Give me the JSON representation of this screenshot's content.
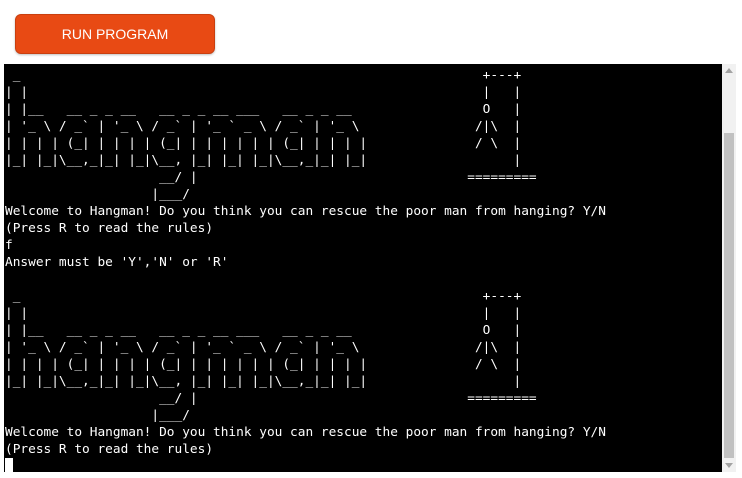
{
  "run_button": {
    "label": "RUN PROGRAM",
    "color": "#e84a14"
  },
  "terminal": {
    "background": "#000000",
    "foreground": "#ffffff",
    "lines": [
      " _                                                            +---+",
      "| |                                                           |   |",
      "| |__   __ _ _ __   __ _ _ __ ___   __ _ _ __                 O   |",
      "| '_ \\ / _` | '_ \\ / _` | '_ ` _ \\ / _` | '_ \\               /|\\  |",
      "| | | | (_| | | | | (_| | | | | | | (_| | | | |              / \\  |",
      "|_| |_|\\__,_|_| |_|\\__, |_| |_| |_|\\__,_|_| |_|                   |",
      "                    __/ |                                   =========",
      "                   |___/",
      "Welcome to Hangman! Do you think you can rescue the poor man from hanging? Y/N",
      "(Press R to read the rules)",
      "f",
      "Answer must be 'Y','N' or 'R'",
      "",
      " _                                                            +---+",
      "| |                                                           |   |",
      "| |__   __ _ _ __   __ _ _ __ ___   __ _ _ __                 O   |",
      "| '_ \\ / _` | '_ \\ / _` | '_ ` _ \\ / _` | '_ \\               /|\\  |",
      "| | | | (_| | | | | (_| | | | | | | (_| | | | |              / \\  |",
      "|_| |_|\\__,_|_| |_|\\__, |_| |_| |_|\\__,_|_| |_|                   |",
      "                    __/ |                                   =========",
      "                   |___/",
      "Welcome to Hangman! Do you think you can rescue the poor man from hanging? Y/N",
      "(Press R to read the rules)"
    ]
  }
}
